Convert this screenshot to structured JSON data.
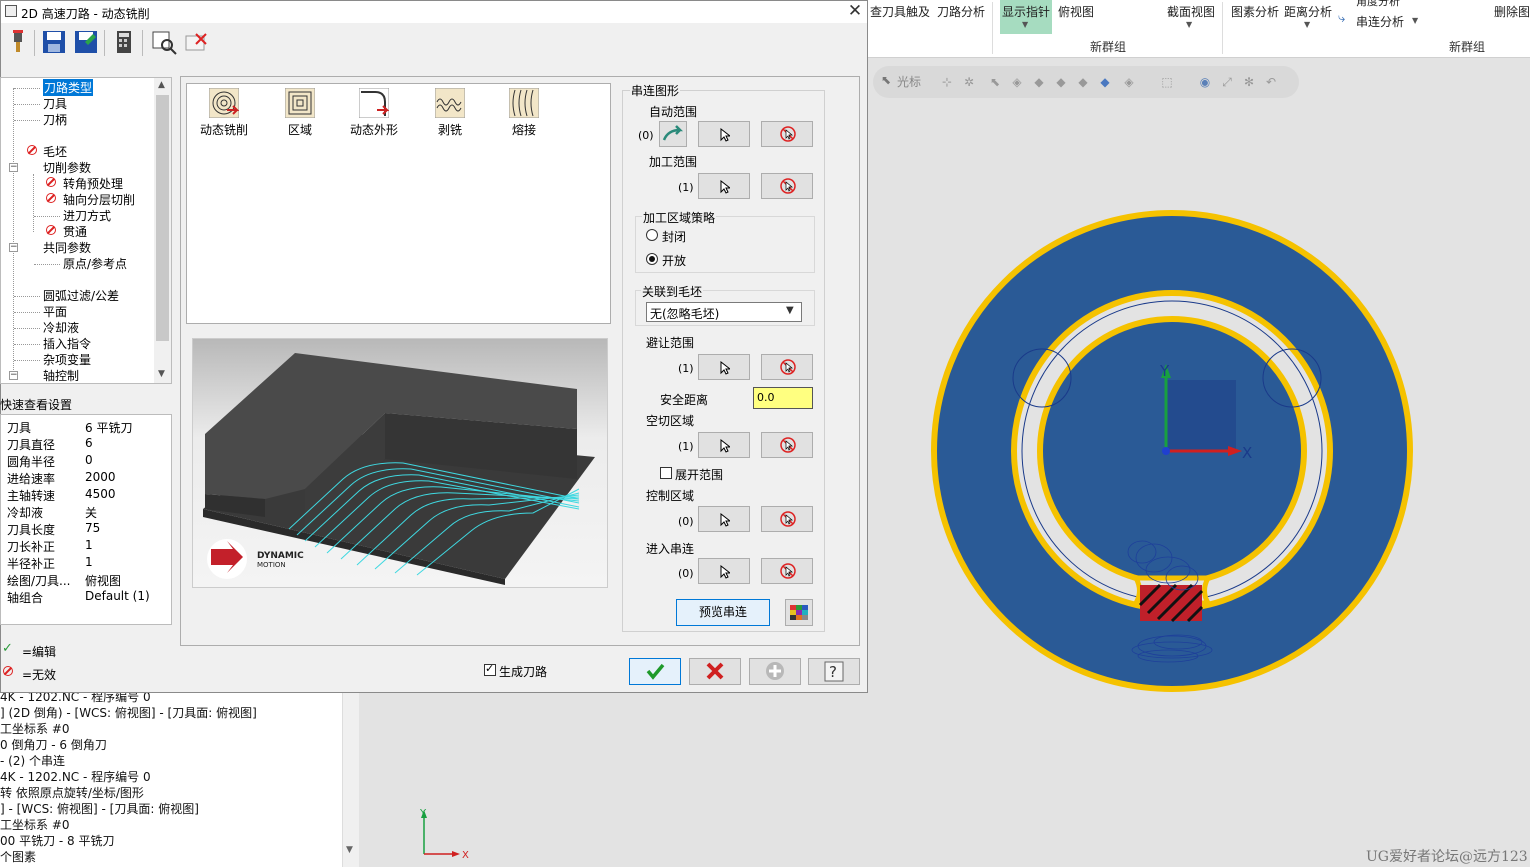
{
  "dialog": {
    "title": "2D 高速刀路 - 动态铣削",
    "close": "✕",
    "toolbar": [
      "tool-icon",
      "save-icon",
      "save-as-icon",
      "calculator-icon",
      "view-icon",
      "delete-icon"
    ]
  },
  "tree": {
    "items": [
      {
        "label": "刀路类型",
        "selected": true
      },
      {
        "label": "刀具"
      },
      {
        "label": "刀柄"
      },
      {
        "label": "毛坯",
        "invalid": true
      },
      {
        "label": "切削参数"
      },
      {
        "label": "转角预处理",
        "invalid": true
      },
      {
        "label": "轴向分层切削",
        "invalid": true
      },
      {
        "label": "进刀方式"
      },
      {
        "label": "贯通",
        "invalid": true
      },
      {
        "label": "共同参数"
      },
      {
        "label": "原点/参考点"
      },
      {
        "label": "圆弧过滤/公差"
      },
      {
        "label": "平面"
      },
      {
        "label": "冷却液"
      },
      {
        "label": "插入指令"
      },
      {
        "label": "杂项变量"
      },
      {
        "label": "轴控制"
      }
    ]
  },
  "quick": {
    "title": "快速查看设置",
    "rows": [
      {
        "key": "刀具",
        "val": "6 平铣刀"
      },
      {
        "key": "刀具直径",
        "val": "6"
      },
      {
        "key": "圆角半径",
        "val": "0"
      },
      {
        "key": "进给速率",
        "val": "2000"
      },
      {
        "key": "主轴转速",
        "val": "4500"
      },
      {
        "key": "冷却液",
        "val": "关"
      },
      {
        "key": "刀具长度",
        "val": "75"
      },
      {
        "key": "刀长补正",
        "val": "1"
      },
      {
        "key": "半径补正",
        "val": "1"
      },
      {
        "key": "绘图/刀具...",
        "val": "俯视图"
      },
      {
        "key": "轴组合",
        "val": "Default (1)"
      }
    ]
  },
  "legend": {
    "edit": "=编辑",
    "invalid": "=无效"
  },
  "types": [
    {
      "label": "动态铣削"
    },
    {
      "label": "区域"
    },
    {
      "label": "动态外形"
    },
    {
      "label": "剥铣"
    },
    {
      "label": "熔接"
    }
  ],
  "preview": {
    "logo_line1": "DYNAMIC",
    "logo_line2": "MOTION"
  },
  "chain": {
    "title": "串连图形",
    "auto_range": {
      "label": "自动范围",
      "count": "(0)"
    },
    "machining_range": {
      "label": "加工范围",
      "count": "(1)"
    },
    "strategy": {
      "label": "加工区域策略",
      "options": [
        "封闭",
        "开放"
      ],
      "selected": "开放"
    },
    "assoc_stock": {
      "label": "关联到毛坯",
      "value": "无(忽略毛坯)"
    },
    "avoid_range": {
      "label": "避让范围",
      "count": "(1)"
    },
    "safe_distance": {
      "label": "安全距离",
      "value": "0.0"
    },
    "air_region": {
      "label": "空切区域",
      "count": "(1)"
    },
    "expand_range": {
      "label": "展开范围",
      "checked": false
    },
    "control_region": {
      "label": "控制区域",
      "count": "(0)"
    },
    "entry_chain": {
      "label": "进入串连",
      "count": "(0)"
    },
    "preview_chain_label": "预览串连"
  },
  "bottom": {
    "generate_toolpath": "生成刀路",
    "generate_checked": true
  },
  "ribbon": {
    "items": [
      "查刀具触及",
      "刀路分析",
      "显示指针",
      "俯视图",
      "截面视图",
      "图素分析",
      "距离分析",
      "角度分析",
      "串连分析",
      "删除图"
    ],
    "groups": [
      "新群组",
      "新群组"
    ]
  },
  "viewbar": {
    "cursor_label": "光标"
  },
  "ops": {
    "lines": [
      "4K - 1202.NC - 程序编号 0",
      "] (2D 倒角) - [WCS: 俯视图] - [刀具面: 俯视图]",
      "工坐标系 #0",
      "0 倒角刀 - 6 倒角刀",
      "- (2) 个串连",
      "4K - 1202.NC - 程序编号 0",
      "转 依照原点旋转/坐标/图形",
      "] - [WCS: 俯视图] - [刀具面: 俯视图]",
      "工坐标系 #0",
      "00 平铣刀 - 8 平铣刀",
      "个图素"
    ]
  },
  "axes": {
    "x": "X",
    "y": "Y"
  },
  "watermark": "UG爱好者论坛@远方123",
  "colors": {
    "part_blue": "#2a5a96",
    "boundary_yellow": "#f5c200",
    "accent": "#0078d7"
  }
}
